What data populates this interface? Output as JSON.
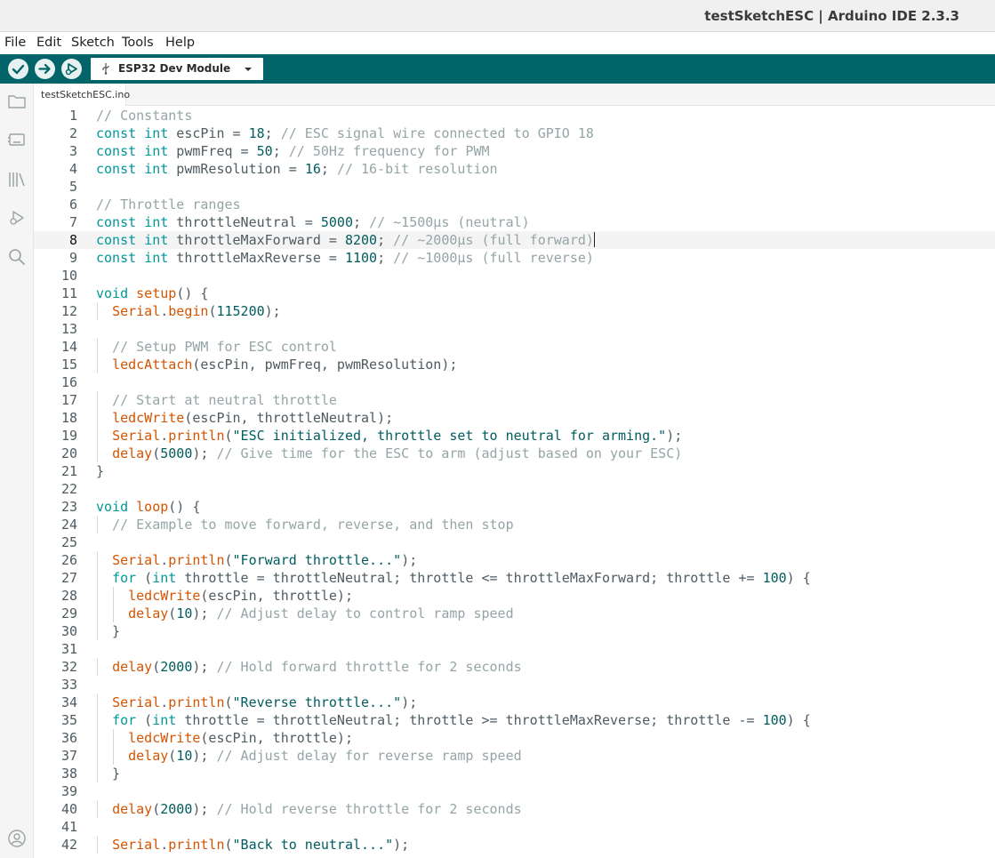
{
  "window": {
    "title": "testSketchESC | Arduino IDE 2.3.3"
  },
  "menu": [
    "File",
    "Edit",
    "Sketch",
    "Tools",
    "Help"
  ],
  "toolbar": {
    "verify_icon": "check-icon",
    "upload_icon": "arrow-right-icon",
    "debug_icon": "debug-play-icon",
    "board_icon": "usb-icon",
    "board": "ESP32 Dev Module"
  },
  "sidebar": [
    "folder-icon",
    "board-manager-icon",
    "library-icon",
    "debug-icon",
    "search-icon",
    "account-icon"
  ],
  "tabs": [
    {
      "label": "testSketchESC.ino"
    }
  ],
  "editor": {
    "current_line": 8,
    "colors": {
      "keyword": "#00979d",
      "function": "#d35400",
      "number": "#005c5f",
      "comment": "#95a5a6",
      "text": "#4e5b61",
      "toolbar": "#006468"
    },
    "lines": [
      [
        [
          "cm",
          "// Constants"
        ]
      ],
      [
        [
          "kw",
          "const"
        ],
        [
          "p",
          " "
        ],
        [
          "kw",
          "int"
        ],
        [
          "p",
          " escPin = "
        ],
        [
          "num",
          "18"
        ],
        [
          "p",
          "; "
        ],
        [
          "cm",
          "// ESC signal wire connected to GPIO 18"
        ]
      ],
      [
        [
          "kw",
          "const"
        ],
        [
          "p",
          " "
        ],
        [
          "kw",
          "int"
        ],
        [
          "p",
          " pwmFreq = "
        ],
        [
          "num",
          "50"
        ],
        [
          "p",
          "; "
        ],
        [
          "cm",
          "// 50Hz frequency for PWM"
        ]
      ],
      [
        [
          "kw",
          "const"
        ],
        [
          "p",
          " "
        ],
        [
          "kw",
          "int"
        ],
        [
          "p",
          " pwmResolution = "
        ],
        [
          "num",
          "16"
        ],
        [
          "p",
          "; "
        ],
        [
          "cm",
          "// 16-bit resolution"
        ]
      ],
      [],
      [
        [
          "cm",
          "// Throttle ranges"
        ]
      ],
      [
        [
          "kw",
          "const"
        ],
        [
          "p",
          " "
        ],
        [
          "kw",
          "int"
        ],
        [
          "p",
          " throttleNeutral = "
        ],
        [
          "num",
          "5000"
        ],
        [
          "p",
          "; "
        ],
        [
          "cm",
          "// ~1500µs (neutral)"
        ]
      ],
      [
        [
          "kw",
          "const"
        ],
        [
          "p",
          " "
        ],
        [
          "kw",
          "int"
        ],
        [
          "p",
          " throttleMaxForward = "
        ],
        [
          "num",
          "8200"
        ],
        [
          "p",
          "; "
        ],
        [
          "cm",
          "// ~2000µs (full forward)"
        ]
      ],
      [
        [
          "kw",
          "const"
        ],
        [
          "p",
          " "
        ],
        [
          "kw",
          "int"
        ],
        [
          "p",
          " throttleMaxReverse = "
        ],
        [
          "num",
          "1100"
        ],
        [
          "p",
          "; "
        ],
        [
          "cm",
          "// ~1000µs (full reverse)"
        ]
      ],
      [],
      [
        [
          "kw",
          "void"
        ],
        [
          "p",
          " "
        ],
        [
          "fn",
          "setup"
        ],
        [
          "p",
          "() {"
        ]
      ],
      [
        [
          "p",
          "  "
        ],
        [
          "fn",
          "Serial"
        ],
        [
          "p",
          "."
        ],
        [
          "fn",
          "begin"
        ],
        [
          "p",
          "("
        ],
        [
          "num",
          "115200"
        ],
        [
          "p",
          ");"
        ]
      ],
      [],
      [
        [
          "p",
          "  "
        ],
        [
          "cm",
          "// Setup PWM for ESC control"
        ]
      ],
      [
        [
          "p",
          "  "
        ],
        [
          "fn",
          "ledcAttach"
        ],
        [
          "p",
          "(escPin, pwmFreq, pwmResolution);"
        ]
      ],
      [],
      [
        [
          "p",
          "  "
        ],
        [
          "cm",
          "// Start at neutral throttle"
        ]
      ],
      [
        [
          "p",
          "  "
        ],
        [
          "fn",
          "ledcWrite"
        ],
        [
          "p",
          "(escPin, throttleNeutral);"
        ]
      ],
      [
        [
          "p",
          "  "
        ],
        [
          "fn",
          "Serial"
        ],
        [
          "p",
          "."
        ],
        [
          "fn",
          "println"
        ],
        [
          "p",
          "("
        ],
        [
          "str",
          "\"ESC initialized, throttle set to neutral for arming.\""
        ],
        [
          "p",
          ");"
        ]
      ],
      [
        [
          "p",
          "  "
        ],
        [
          "fn",
          "delay"
        ],
        [
          "p",
          "("
        ],
        [
          "num",
          "5000"
        ],
        [
          "p",
          "); "
        ],
        [
          "cm",
          "// Give time for the ESC to arm (adjust based on your ESC)"
        ]
      ],
      [
        [
          "p",
          "}"
        ]
      ],
      [],
      [
        [
          "kw",
          "void"
        ],
        [
          "p",
          " "
        ],
        [
          "fn",
          "loop"
        ],
        [
          "p",
          "() {"
        ]
      ],
      [
        [
          "p",
          "  "
        ],
        [
          "cm",
          "// Example to move forward, reverse, and then stop"
        ]
      ],
      [],
      [
        [
          "p",
          "  "
        ],
        [
          "fn",
          "Serial"
        ],
        [
          "p",
          "."
        ],
        [
          "fn",
          "println"
        ],
        [
          "p",
          "("
        ],
        [
          "str",
          "\"Forward throttle...\""
        ],
        [
          "p",
          ");"
        ]
      ],
      [
        [
          "p",
          "  "
        ],
        [
          "kw",
          "for"
        ],
        [
          "p",
          " ("
        ],
        [
          "kw",
          "int"
        ],
        [
          "p",
          " throttle = throttleNeutral; throttle <= throttleMaxForward; throttle += "
        ],
        [
          "num",
          "100"
        ],
        [
          "p",
          ") {"
        ]
      ],
      [
        [
          "p",
          "    "
        ],
        [
          "fn",
          "ledcWrite"
        ],
        [
          "p",
          "(escPin, throttle);"
        ]
      ],
      [
        [
          "p",
          "    "
        ],
        [
          "fn",
          "delay"
        ],
        [
          "p",
          "("
        ],
        [
          "num",
          "10"
        ],
        [
          "p",
          "); "
        ],
        [
          "cm",
          "// Adjust delay to control ramp speed"
        ]
      ],
      [
        [
          "p",
          "  }"
        ]
      ],
      [],
      [
        [
          "p",
          "  "
        ],
        [
          "fn",
          "delay"
        ],
        [
          "p",
          "("
        ],
        [
          "num",
          "2000"
        ],
        [
          "p",
          "); "
        ],
        [
          "cm",
          "// Hold forward throttle for 2 seconds"
        ]
      ],
      [],
      [
        [
          "p",
          "  "
        ],
        [
          "fn",
          "Serial"
        ],
        [
          "p",
          "."
        ],
        [
          "fn",
          "println"
        ],
        [
          "p",
          "("
        ],
        [
          "str",
          "\"Reverse throttle...\""
        ],
        [
          "p",
          ");"
        ]
      ],
      [
        [
          "p",
          "  "
        ],
        [
          "kw",
          "for"
        ],
        [
          "p",
          " ("
        ],
        [
          "kw",
          "int"
        ],
        [
          "p",
          " throttle = throttleNeutral; throttle >= throttleMaxReverse; throttle -= "
        ],
        [
          "num",
          "100"
        ],
        [
          "p",
          ") {"
        ]
      ],
      [
        [
          "p",
          "    "
        ],
        [
          "fn",
          "ledcWrite"
        ],
        [
          "p",
          "(escPin, throttle);"
        ]
      ],
      [
        [
          "p",
          "    "
        ],
        [
          "fn",
          "delay"
        ],
        [
          "p",
          "("
        ],
        [
          "num",
          "10"
        ],
        [
          "p",
          "); "
        ],
        [
          "cm",
          "// Adjust delay for reverse ramp speed"
        ]
      ],
      [
        [
          "p",
          "  }"
        ]
      ],
      [],
      [
        [
          "p",
          "  "
        ],
        [
          "fn",
          "delay"
        ],
        [
          "p",
          "("
        ],
        [
          "num",
          "2000"
        ],
        [
          "p",
          "); "
        ],
        [
          "cm",
          "// Hold reverse throttle for 2 seconds"
        ]
      ],
      [],
      [
        [
          "p",
          "  "
        ],
        [
          "fn",
          "Serial"
        ],
        [
          "p",
          "."
        ],
        [
          "fn",
          "println"
        ],
        [
          "p",
          "("
        ],
        [
          "str",
          "\"Back to neutral...\""
        ],
        [
          "p",
          ");"
        ]
      ]
    ]
  }
}
